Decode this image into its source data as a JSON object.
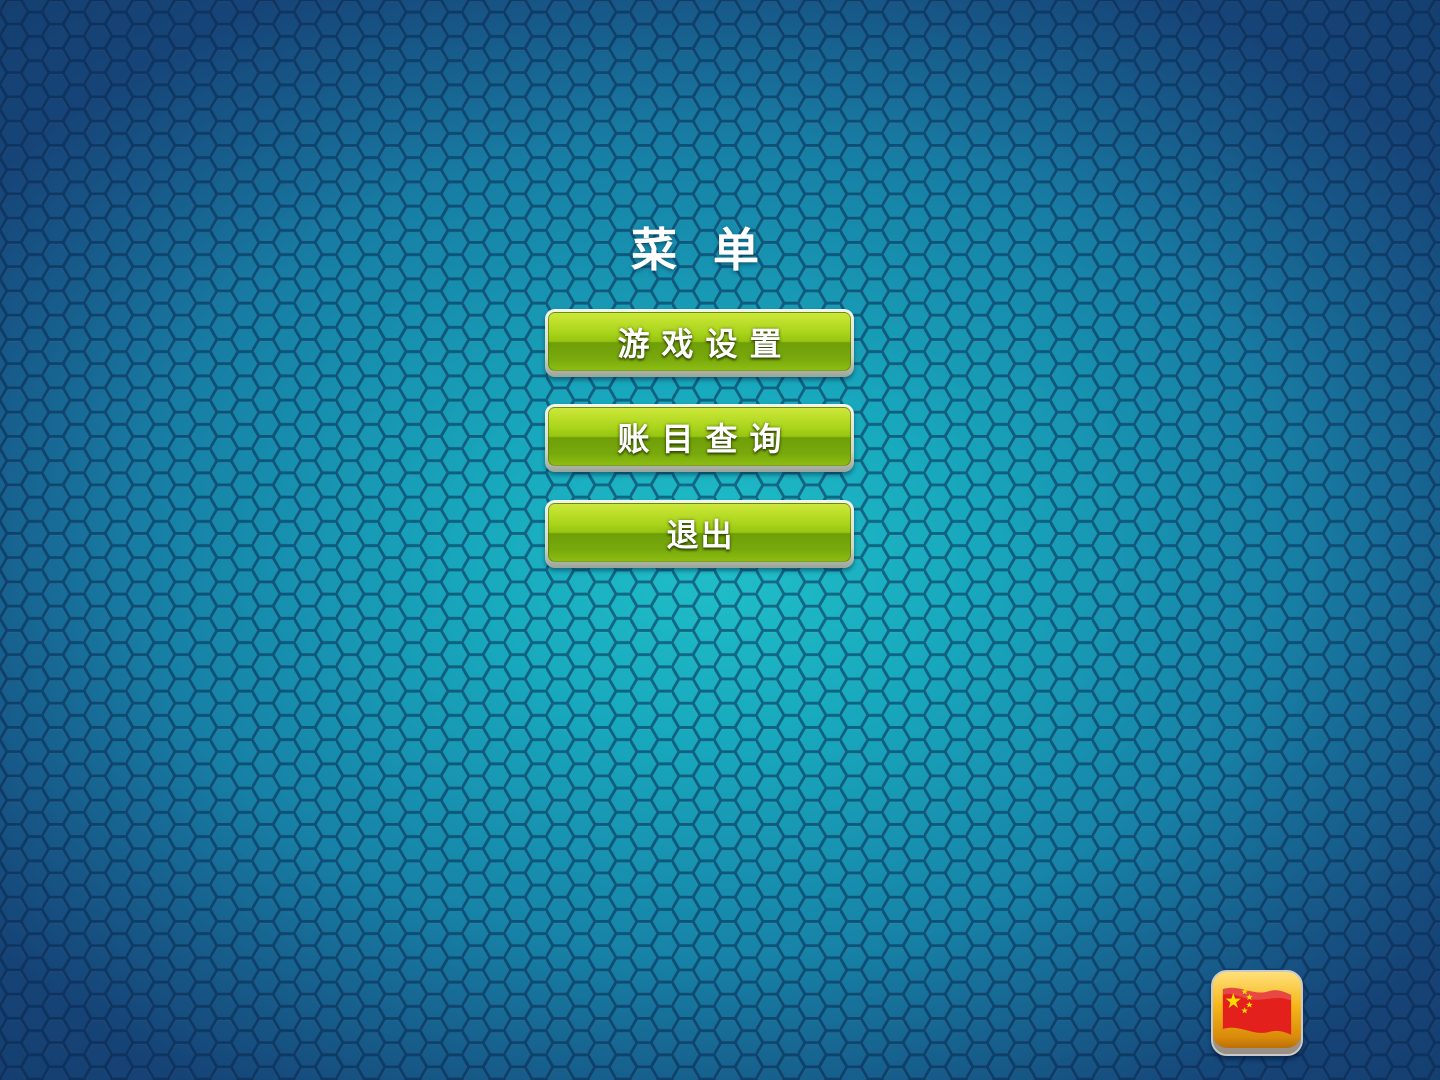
{
  "menu": {
    "title": "菜 单",
    "buttons": {
      "settings": "游戏设置",
      "account": "账目查询",
      "exit": "退出"
    }
  },
  "language_button": {
    "icon": "china-flag-icon"
  },
  "colors": {
    "background_center": "#20bfc9",
    "background_edge": "#1a4f86",
    "button_green": "#95c411",
    "language_button_gold": "#f7b81c",
    "flag_red": "#e3201b",
    "flag_star": "#ffde00"
  }
}
